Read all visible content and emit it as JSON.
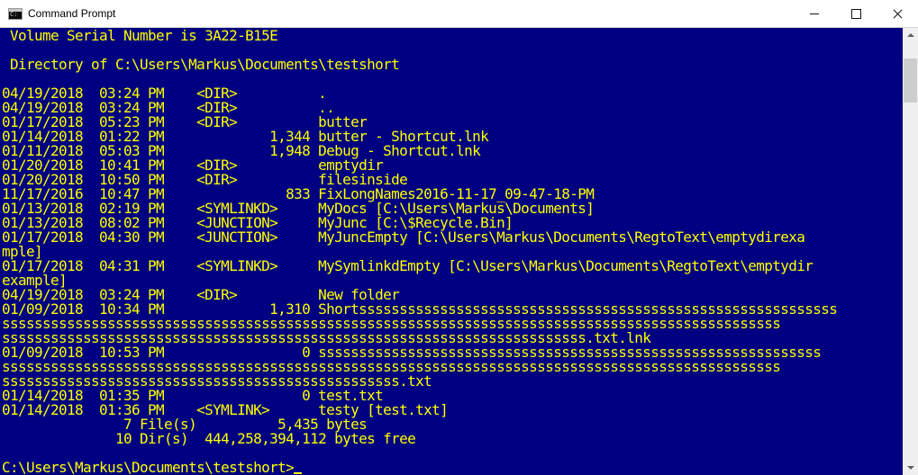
{
  "window": {
    "title": "Command Prompt",
    "icon": "cmd-icon",
    "controls": [
      "minimize-icon",
      "maximize-icon",
      "close-icon"
    ]
  },
  "colors": {
    "background": "#000080",
    "foreground": "#ffff00",
    "titlebar": "#ffffff"
  },
  "console": {
    "lines": [
      " Volume Serial Number is 3A22-B15E",
      "",
      " Directory of C:\\Users\\Markus\\Documents\\testshort",
      "",
      "04/19/2018  03:24 PM    <DIR>          .",
      "04/19/2018  03:24 PM    <DIR>          ..",
      "01/17/2018  05:23 PM    <DIR>          butter",
      "01/14/2018  01:22 PM             1,344 butter - Shortcut.lnk",
      "01/11/2018  05:03 PM             1,948 Debug - Shortcut.lnk",
      "01/20/2018  10:41 PM    <DIR>          emptydir",
      "01/20/2018  10:50 PM    <DIR>          filesinside",
      "11/17/2016  10:47 PM               833 FixLongNames2016-11-17_09-47-18-PM",
      "01/13/2018  02:19 PM    <SYMLINKD>     MyDocs [C:\\Users\\Markus\\Documents]",
      "01/13/2018  08:02 PM    <JUNCTION>     MyJunc [C:\\$Recycle.Bin]",
      "01/17/2018  04:30 PM    <JUNCTION>     MyJuncEmpty [C:\\Users\\Markus\\Documents\\RegtoText\\emptydirexa",
      "mple]",
      "01/17/2018  04:31 PM    <SYMLINKD>     MySymlinkdEmpty [C:\\Users\\Markus\\Documents\\RegtoText\\emptydir",
      "example]",
      "04/19/2018  03:24 PM    <DIR>          New folder",
      "01/09/2018  10:34 PM             1,310 Shortsssssssssssssssssssssssssssssssssssssssssssssssssssssssssss",
      "ssssssssssssssssssssssssssssssssssssssssssssssssssssssssssssssssssssssssssssssssssssssssssssssss",
      "ssssssssssssssssssssssssssssssssssssssssssssssssssssssssssssssssssssssss.txt.lnk",
      "01/09/2018  10:53 PM                 0 ssssssssssssssssssssssssssssssssssssssssssssssssssssssssssssss",
      "ssssssssssssssssssssssssssssssssssssssssssssssssssssssssssssssssssssssssssssssssssssssssssssssss",
      "sssssssssssssssssssssssssssssssssssssssssssssssss.txt",
      "01/14/2018  01:35 PM                 0 test.txt",
      "01/14/2018  01:36 PM    <SYMLINK>      testy [test.txt]",
      "               7 File(s)          5,435 bytes",
      "              10 Dir(s)  444,258,394,112 bytes free",
      ""
    ],
    "prompt": "C:\\Users\\Markus\\Documents\\testshort>"
  }
}
